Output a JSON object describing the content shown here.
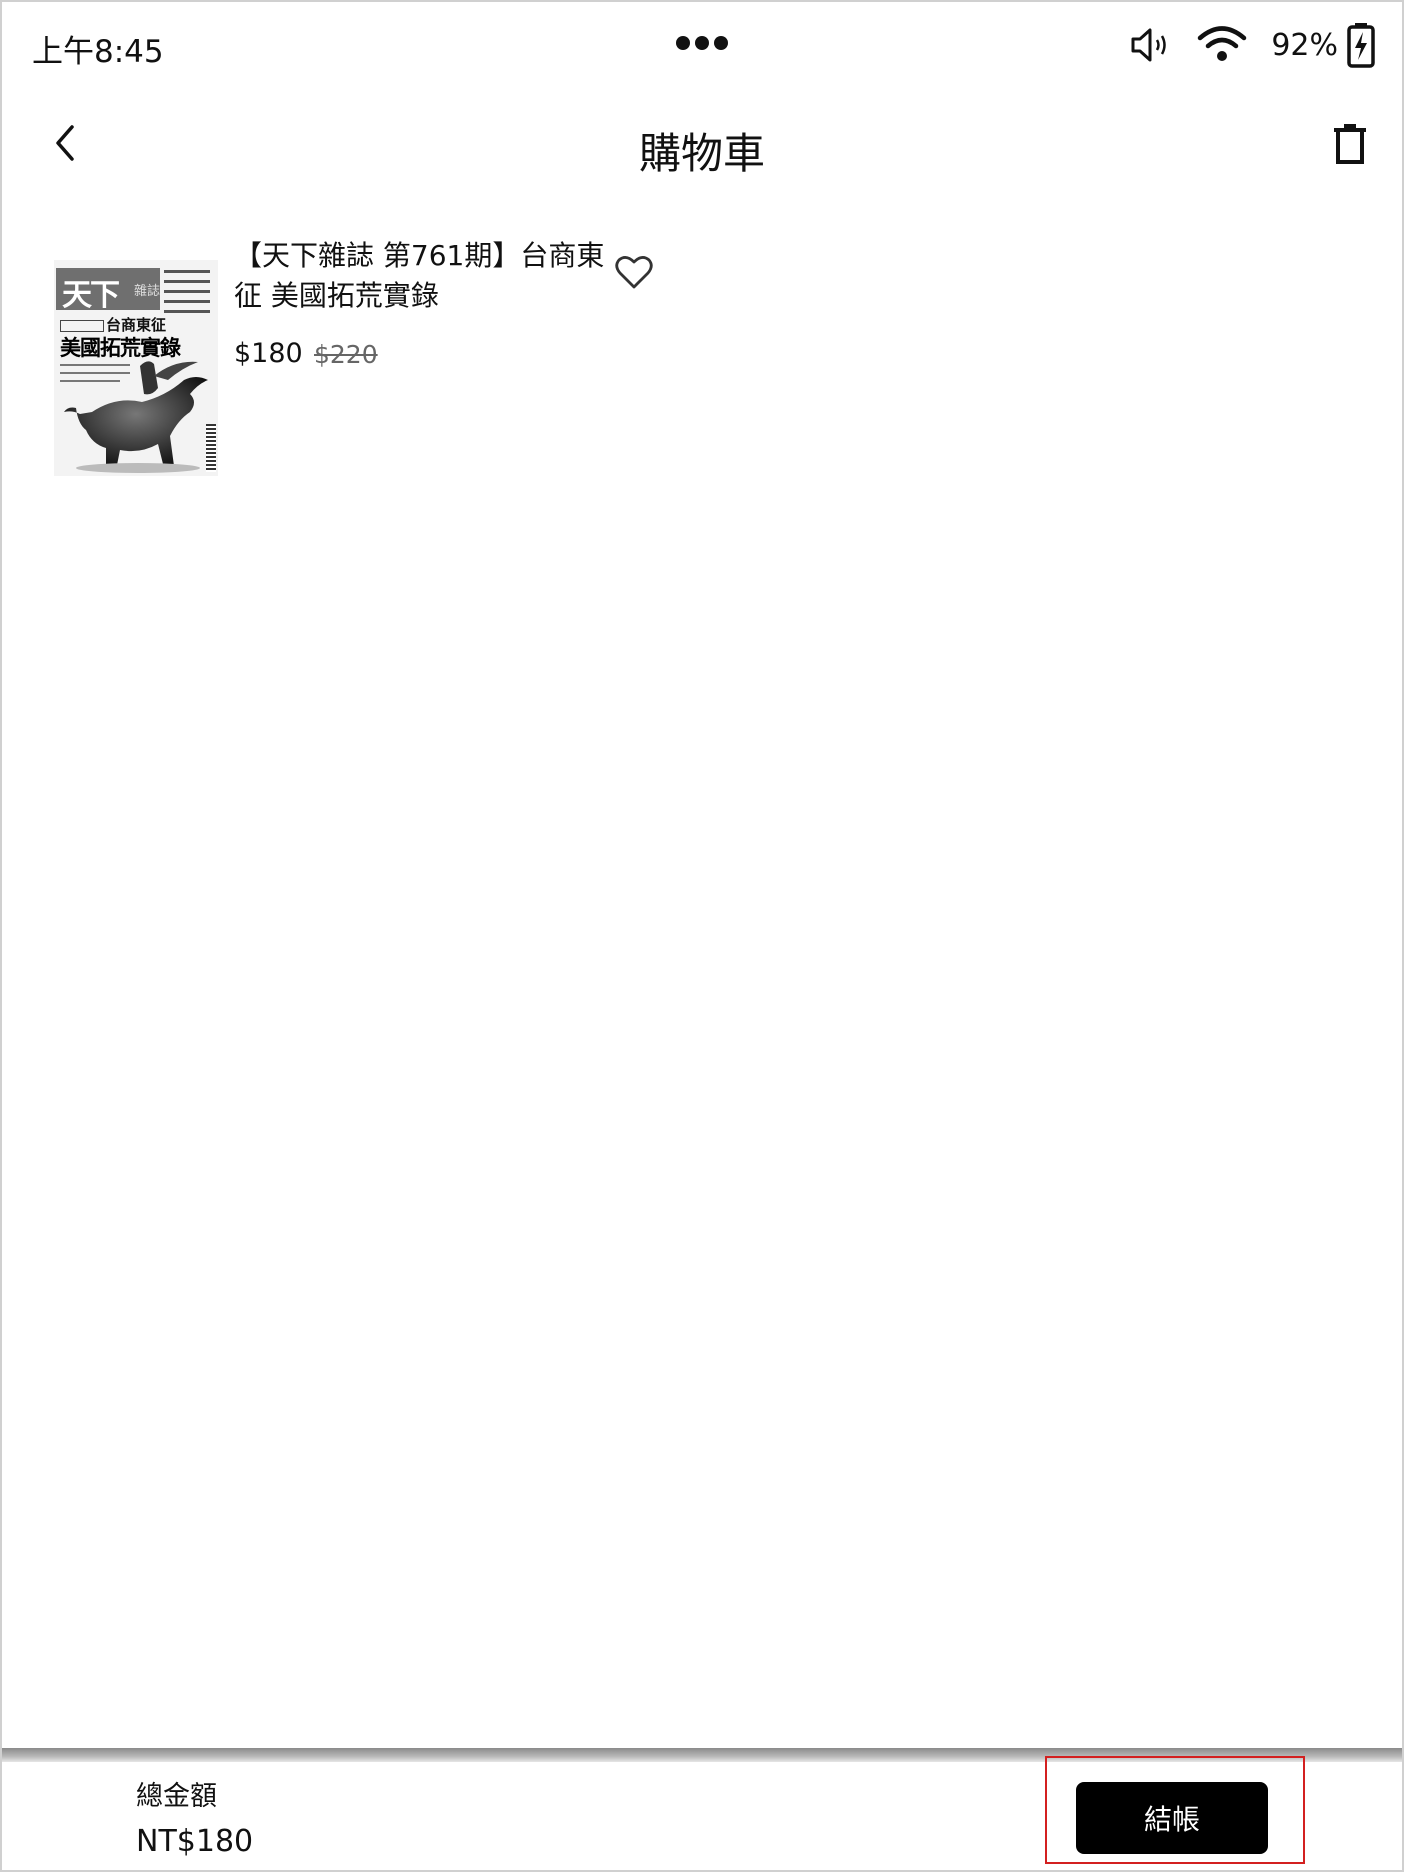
{
  "status_bar": {
    "time": "上午8:45",
    "battery_percent": "92%",
    "icons": [
      "more-dots-icon",
      "volume-icon",
      "wifi-icon",
      "battery-charging-icon"
    ]
  },
  "header": {
    "title": "購物車",
    "back_icon": "chevron-left-icon",
    "delete_icon": "trash-icon"
  },
  "cart": {
    "items": [
      {
        "title": "【天下雜誌 第761期】台商東征 美國拓荒實錄",
        "price": "$180",
        "original_price": "$220",
        "cover": {
          "logo": "天下",
          "logo_small": "雜誌",
          "subheadline": "台商東征",
          "headline": "美國拓荒實錄"
        },
        "favorite_icon": "heart-outline-icon"
      }
    ]
  },
  "footer": {
    "total_label": "總金額",
    "total_value": "NT$180",
    "checkout_label": "結帳"
  },
  "colors": {
    "highlight": "#d32020",
    "button": "#000000"
  }
}
